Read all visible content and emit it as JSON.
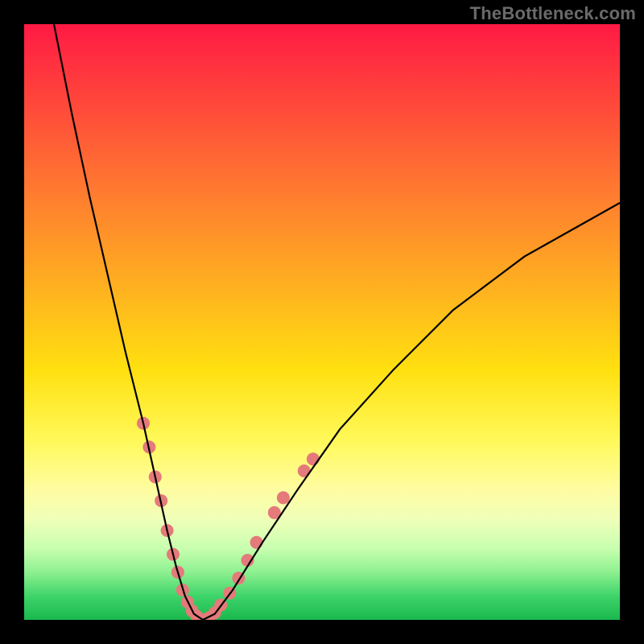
{
  "watermark": "TheBottleneck.com",
  "chart_data": {
    "type": "line",
    "title": "",
    "xlabel": "",
    "ylabel": "",
    "xlim": [
      0,
      100
    ],
    "ylim": [
      0,
      100
    ],
    "grid": false,
    "legend": false,
    "series": [
      {
        "name": "bottleneck-curve",
        "x": [
          5,
          8,
          11,
          14,
          17,
          20,
          22,
          24,
          25.5,
          27,
          28.5,
          30,
          32,
          35,
          40,
          46,
          53,
          62,
          72,
          84,
          100
        ],
        "y": [
          100,
          85,
          71,
          58,
          45,
          33,
          24,
          15,
          9,
          4,
          1,
          0,
          1,
          5,
          13,
          22,
          32,
          42,
          52,
          61,
          70
        ],
        "color": "#000000"
      }
    ],
    "markers": [
      {
        "name": "highlight-dots",
        "color": "#e47a7a",
        "radius": 8,
        "points": [
          {
            "x": 20.0,
            "y": 33
          },
          {
            "x": 21.0,
            "y": 29
          },
          {
            "x": 22.0,
            "y": 24
          },
          {
            "x": 23.0,
            "y": 20
          },
          {
            "x": 24.0,
            "y": 15
          },
          {
            "x": 25.0,
            "y": 11
          },
          {
            "x": 25.8,
            "y": 8
          },
          {
            "x": 26.6,
            "y": 5
          },
          {
            "x": 27.4,
            "y": 3
          },
          {
            "x": 28.2,
            "y": 1.5
          },
          {
            "x": 29.0,
            "y": 0.6
          },
          {
            "x": 30.0,
            "y": 0
          },
          {
            "x": 31.0,
            "y": 0.3
          },
          {
            "x": 32.0,
            "y": 1.2
          },
          {
            "x": 33.0,
            "y": 2.5
          },
          {
            "x": 34.5,
            "y": 4.5
          },
          {
            "x": 36.0,
            "y": 7
          },
          {
            "x": 37.5,
            "y": 10
          },
          {
            "x": 39.0,
            "y": 13
          },
          {
            "x": 42.0,
            "y": 18
          },
          {
            "x": 43.5,
            "y": 20.5
          },
          {
            "x": 47.0,
            "y": 25
          },
          {
            "x": 48.5,
            "y": 27
          }
        ]
      }
    ],
    "background_gradient": {
      "direction": "vertical",
      "stops": [
        {
          "pos": 0.0,
          "color": "#ff1a44"
        },
        {
          "pos": 0.28,
          "color": "#ff7a30"
        },
        {
          "pos": 0.58,
          "color": "#ffe010"
        },
        {
          "pos": 0.78,
          "color": "#fffca0"
        },
        {
          "pos": 0.92,
          "color": "#8ef090"
        },
        {
          "pos": 1.0,
          "color": "#1ab84e"
        }
      ]
    }
  }
}
